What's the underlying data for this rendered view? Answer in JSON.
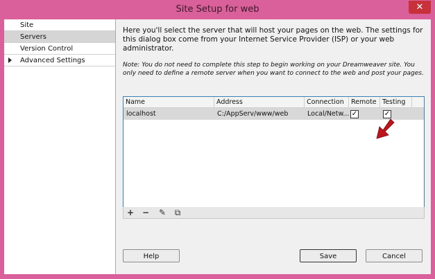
{
  "window": {
    "title": "Site Setup for web",
    "close_glyph": "✕"
  },
  "sidebar": {
    "items": [
      {
        "label": "Site"
      },
      {
        "label": "Servers"
      },
      {
        "label": "Version Control"
      },
      {
        "label": "Advanced Settings"
      }
    ]
  },
  "main": {
    "intro": "Here you'll select the server that will host your pages on the web. The settings for this dialog box come from your Internet Service Provider (ISP) or your web administrator.",
    "note": "Note: You do not need to complete this step to begin working on your Dreamweaver site. You only need to define a remote server when you want to connect to the web and post your pages."
  },
  "servers_table": {
    "columns": [
      "Name",
      "Address",
      "Connection",
      "Remote",
      "Testing"
    ],
    "rows": [
      {
        "name": "localhost",
        "address": "C:/AppServ/www/web",
        "connection": "Local/Netw...",
        "remote": true,
        "testing": true
      }
    ]
  },
  "toolbar": {
    "add_glyph": "+",
    "remove_glyph": "−",
    "edit_glyph": "✎",
    "duplicate_glyph": "⧉"
  },
  "buttons": {
    "help": "Help",
    "save": "Save",
    "cancel": "Cancel"
  },
  "colors": {
    "window_frame": "#d9609a",
    "close_button": "#c7323a",
    "table_border": "#3c7fb1",
    "annotation_arrow": "#c0141c"
  }
}
